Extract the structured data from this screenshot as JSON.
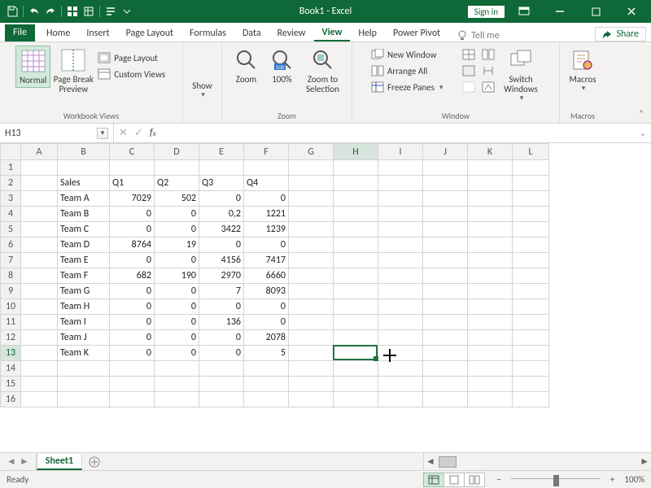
{
  "titlebar": {
    "title": "Book1  -  Excel",
    "signin": "Sign in"
  },
  "tabs": {
    "file": "File",
    "home": "Home",
    "insert": "Insert",
    "pagelayout": "Page Layout",
    "formulas": "Formulas",
    "data": "Data",
    "review": "Review",
    "view": "View",
    "help": "Help",
    "powerpivot": "Power Pivot",
    "tellme": "Tell me",
    "share": "Share"
  },
  "ribbon": {
    "normal": "Normal",
    "pagebreak": "Page Break\nPreview",
    "pagelayout": "Page Layout",
    "customviews": "Custom Views",
    "show": "Show",
    "zoom": "Zoom",
    "hundred": "100%",
    "zoomselection": "Zoom to\nSelection",
    "newwindow": "New Window",
    "arrange": "Arrange All",
    "freeze": "Freeze Panes",
    "switch": "Switch\nWindows",
    "macros": "Macros",
    "groups": {
      "views": "Workbook Views",
      "zoom": "Zoom",
      "window": "Window",
      "macros": "Macros"
    }
  },
  "namebox": {
    "ref": "H13"
  },
  "columns": [
    "A",
    "B",
    "C",
    "D",
    "E",
    "F",
    "G",
    "H",
    "I",
    "J",
    "K",
    "L"
  ],
  "rows": [
    "1",
    "2",
    "3",
    "4",
    "5",
    "6",
    "7",
    "8",
    "9",
    "10",
    "11",
    "12",
    "13",
    "14",
    "15",
    "16"
  ],
  "data": {
    "B2": "Sales",
    "C2": "Q1",
    "D2": "Q2",
    "E2": "Q3",
    "F2": "Q4",
    "B3": "Team A",
    "C3": "7029",
    "D3": "502",
    "E3": "0",
    "F3": "0",
    "B4": "Team B",
    "C4": "0",
    "D4": "0",
    "E4": "0,2",
    "F4": "1221",
    "B5": "Team C",
    "C5": "0",
    "D5": "0",
    "E5": "3422",
    "F5": "1239",
    "B6": "Team D",
    "C6": "8764",
    "D6": "19",
    "E6": "0",
    "F6": "0",
    "B7": "Team E",
    "C7": "0",
    "D7": "0",
    "E7": "4156",
    "F7": "7417",
    "B8": "Team F",
    "C8": "682",
    "D8": "190",
    "E8": "2970",
    "F8": "6660",
    "B9": "Team G",
    "C9": "0",
    "D9": "0",
    "E9": "7",
    "F9": "8093",
    "B10": "Team H",
    "C10": "0",
    "D10": "0",
    "E10": "0",
    "F10": "0",
    "B11": "Team I",
    "C11": "0",
    "D11": "0",
    "E11": "136",
    "F11": "0",
    "B12": "Team J",
    "C12": "0",
    "D12": "0",
    "E12": "0",
    "F12": "2078",
    "B13": "Team K",
    "C13": "0",
    "D13": "0",
    "E13": "0",
    "F13": "5"
  },
  "sheet": {
    "active": "Sheet1"
  },
  "status": {
    "ready": "Ready",
    "zoom": "100%"
  },
  "chart_data": {
    "type": "table",
    "title": "Sales",
    "categories": [
      "Q1",
      "Q2",
      "Q3",
      "Q4"
    ],
    "series": [
      {
        "name": "Team A",
        "values": [
          7029,
          502,
          0,
          0
        ]
      },
      {
        "name": "Team B",
        "values": [
          0,
          0,
          0.2,
          1221
        ]
      },
      {
        "name": "Team C",
        "values": [
          0,
          0,
          3422,
          1239
        ]
      },
      {
        "name": "Team D",
        "values": [
          8764,
          19,
          0,
          0
        ]
      },
      {
        "name": "Team E",
        "values": [
          0,
          0,
          4156,
          7417
        ]
      },
      {
        "name": "Team F",
        "values": [
          682,
          190,
          2970,
          6660
        ]
      },
      {
        "name": "Team G",
        "values": [
          0,
          0,
          7,
          8093
        ]
      },
      {
        "name": "Team H",
        "values": [
          0,
          0,
          0,
          0
        ]
      },
      {
        "name": "Team I",
        "values": [
          0,
          0,
          136,
          0
        ]
      },
      {
        "name": "Team J",
        "values": [
          0,
          0,
          0,
          2078
        ]
      },
      {
        "name": "Team K",
        "values": [
          0,
          0,
          0,
          5
        ]
      }
    ]
  }
}
